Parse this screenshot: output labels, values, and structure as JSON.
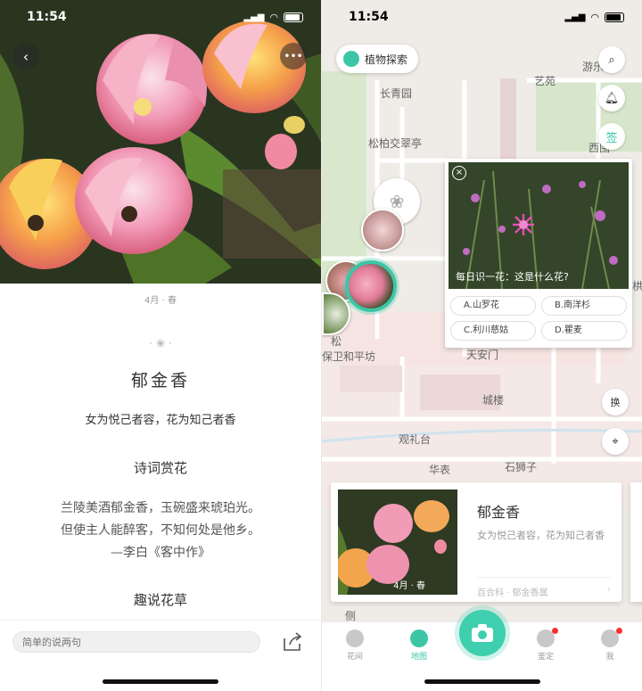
{
  "status": {
    "time": "11:54"
  },
  "detail": {
    "season": "4月 · 春",
    "title": "郁金香",
    "subtitle": "女为悦己者容，花为知己者香",
    "poem_section": "诗词赏花",
    "poem_lines": [
      "兰陵美酒郁金香，玉碗盛来琥珀光。",
      "但使主人能醉客，不知何处是他乡。",
      "—李白《客中作》"
    ],
    "fun_section": "趣说花草",
    "comment_placeholder": "简单的说两句"
  },
  "map": {
    "explore_label": "植物探索",
    "sign_label": "签",
    "swap_label": "换",
    "labels": {
      "changqingyuan": "长青园",
      "songbai": "松柏交翠亭",
      "yiyuan": "艺苑",
      "youle": "游乐",
      "xilan": "西围",
      "tianan": "天安门",
      "chenglou": "城楼",
      "guanlitai": "观礼台",
      "huabiao": "华表",
      "shishizi": "石狮子",
      "weiping": "保卫和平坊",
      "song": "松",
      "ce": "侧",
      "tuo": "栱"
    },
    "quiz": {
      "question": "每日识一花：这是什么花?",
      "options": [
        "A.山罗花",
        "B.南洋杉",
        "C.利川慈姑",
        "D.瞿麦"
      ]
    },
    "card": {
      "title": "郁金香",
      "desc": "女为悦己者容，花为知己者香",
      "badge": "4月 · 春",
      "meta": "百合科 · 郁金香属"
    },
    "tabs": [
      "花间",
      "地图",
      "鉴定",
      "我"
    ]
  },
  "colors": {
    "accent": "#3cc6a6",
    "badge": "#ff3030"
  }
}
